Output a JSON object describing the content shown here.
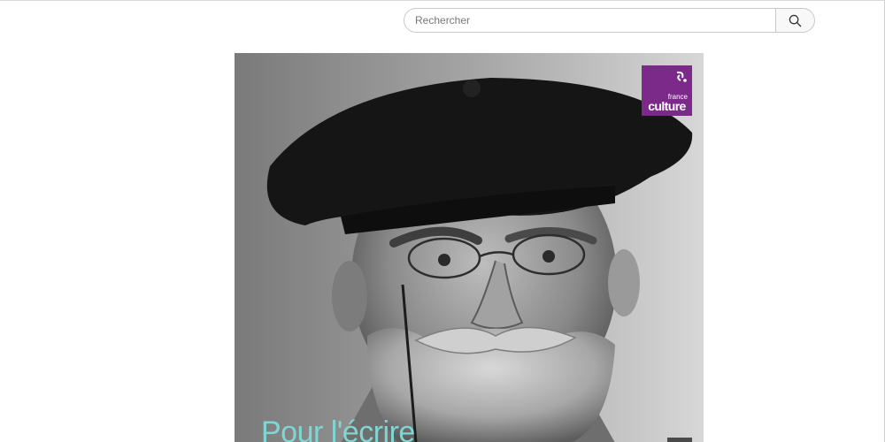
{
  "search": {
    "placeholder": "Rechercher",
    "icon": "search-icon"
  },
  "cover": {
    "title": "Pour l'écrire",
    "logo": {
      "small_text": "france",
      "big_text": "culture",
      "color": "#7b2a8a"
    },
    "title_color": "#7fd6d2"
  }
}
